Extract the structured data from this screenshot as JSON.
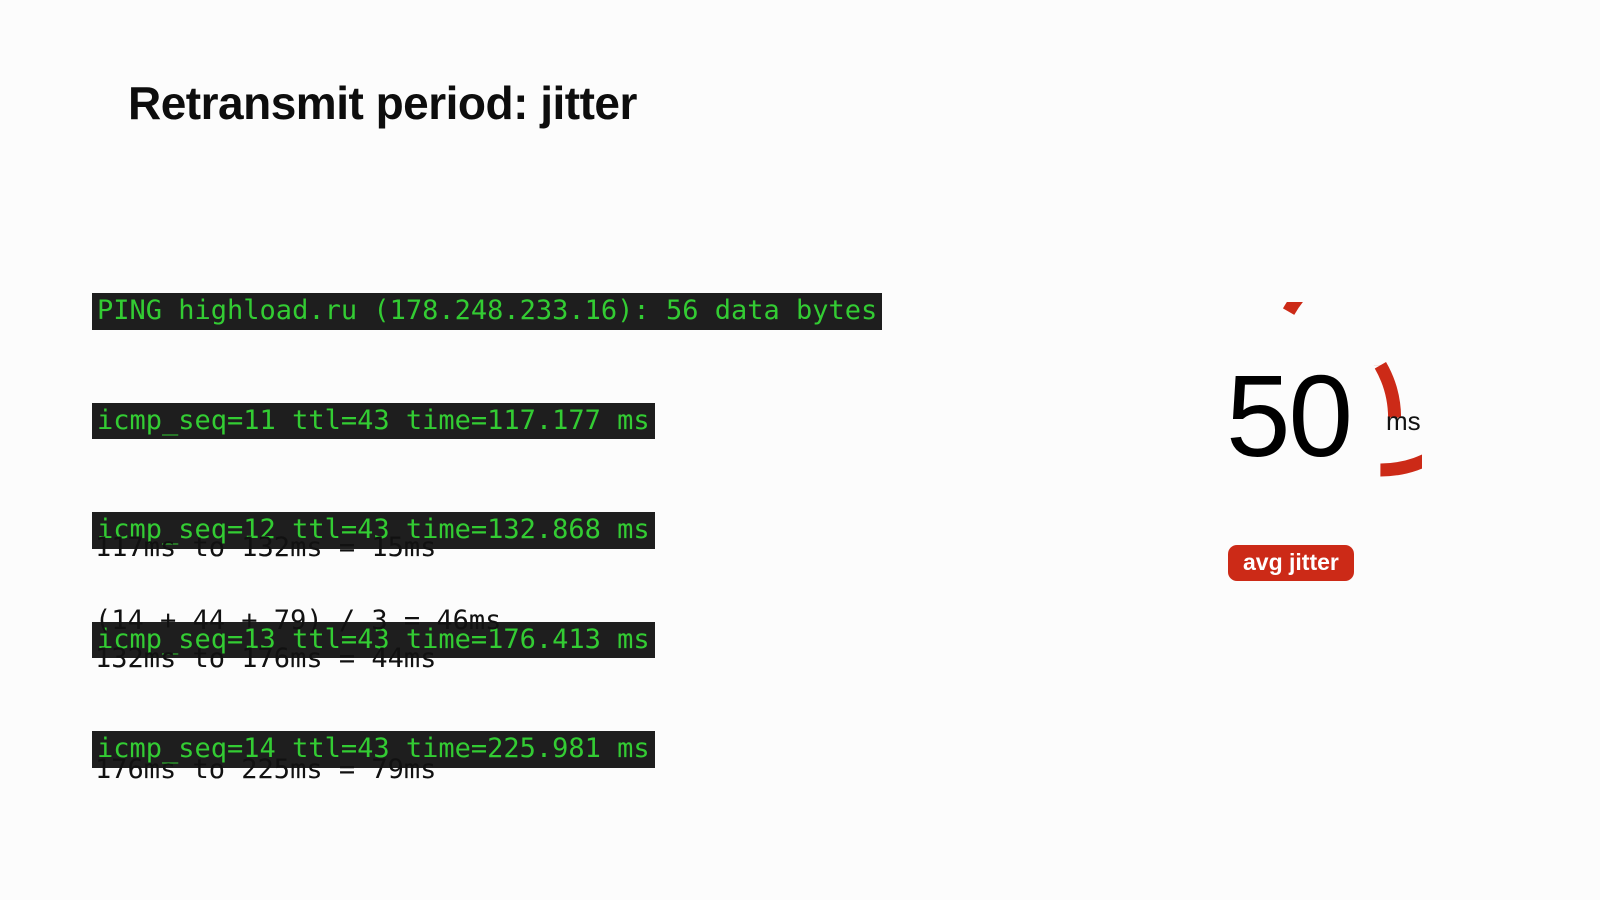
{
  "slide": {
    "title": "Retransmit period: jitter",
    "background_color": "#fcfcfc"
  },
  "terminal": {
    "background_color": "#1e1e1e",
    "text_color": "#33cc33",
    "lines": [
      "PING highload.ru (178.248.233.16): 56 data bytes",
      "icmp_seq=11 ttl=43 time=117.177 ms",
      "icmp_seq=12 ttl=43 time=132.868 ms",
      "icmp_seq=13 ttl=43 time=176.413 ms",
      "icmp_seq=14 ttl=43 time=225.981 ms"
    ]
  },
  "calculations": {
    "deltas": [
      "117ms to 132ms = 15ms",
      "132ms to 176ms = 44ms",
      "176ms to 225ms = 79ms"
    ],
    "average": "(14 + 44 + 79) / 3 = 46ms"
  },
  "gauge": {
    "value": "50",
    "unit": "ms",
    "badge_label": "avg jitter",
    "ring_color": "#cc2a17",
    "value_color": "#000000",
    "badge_background": "#cc2a17",
    "badge_text_color": "#ffffff"
  }
}
